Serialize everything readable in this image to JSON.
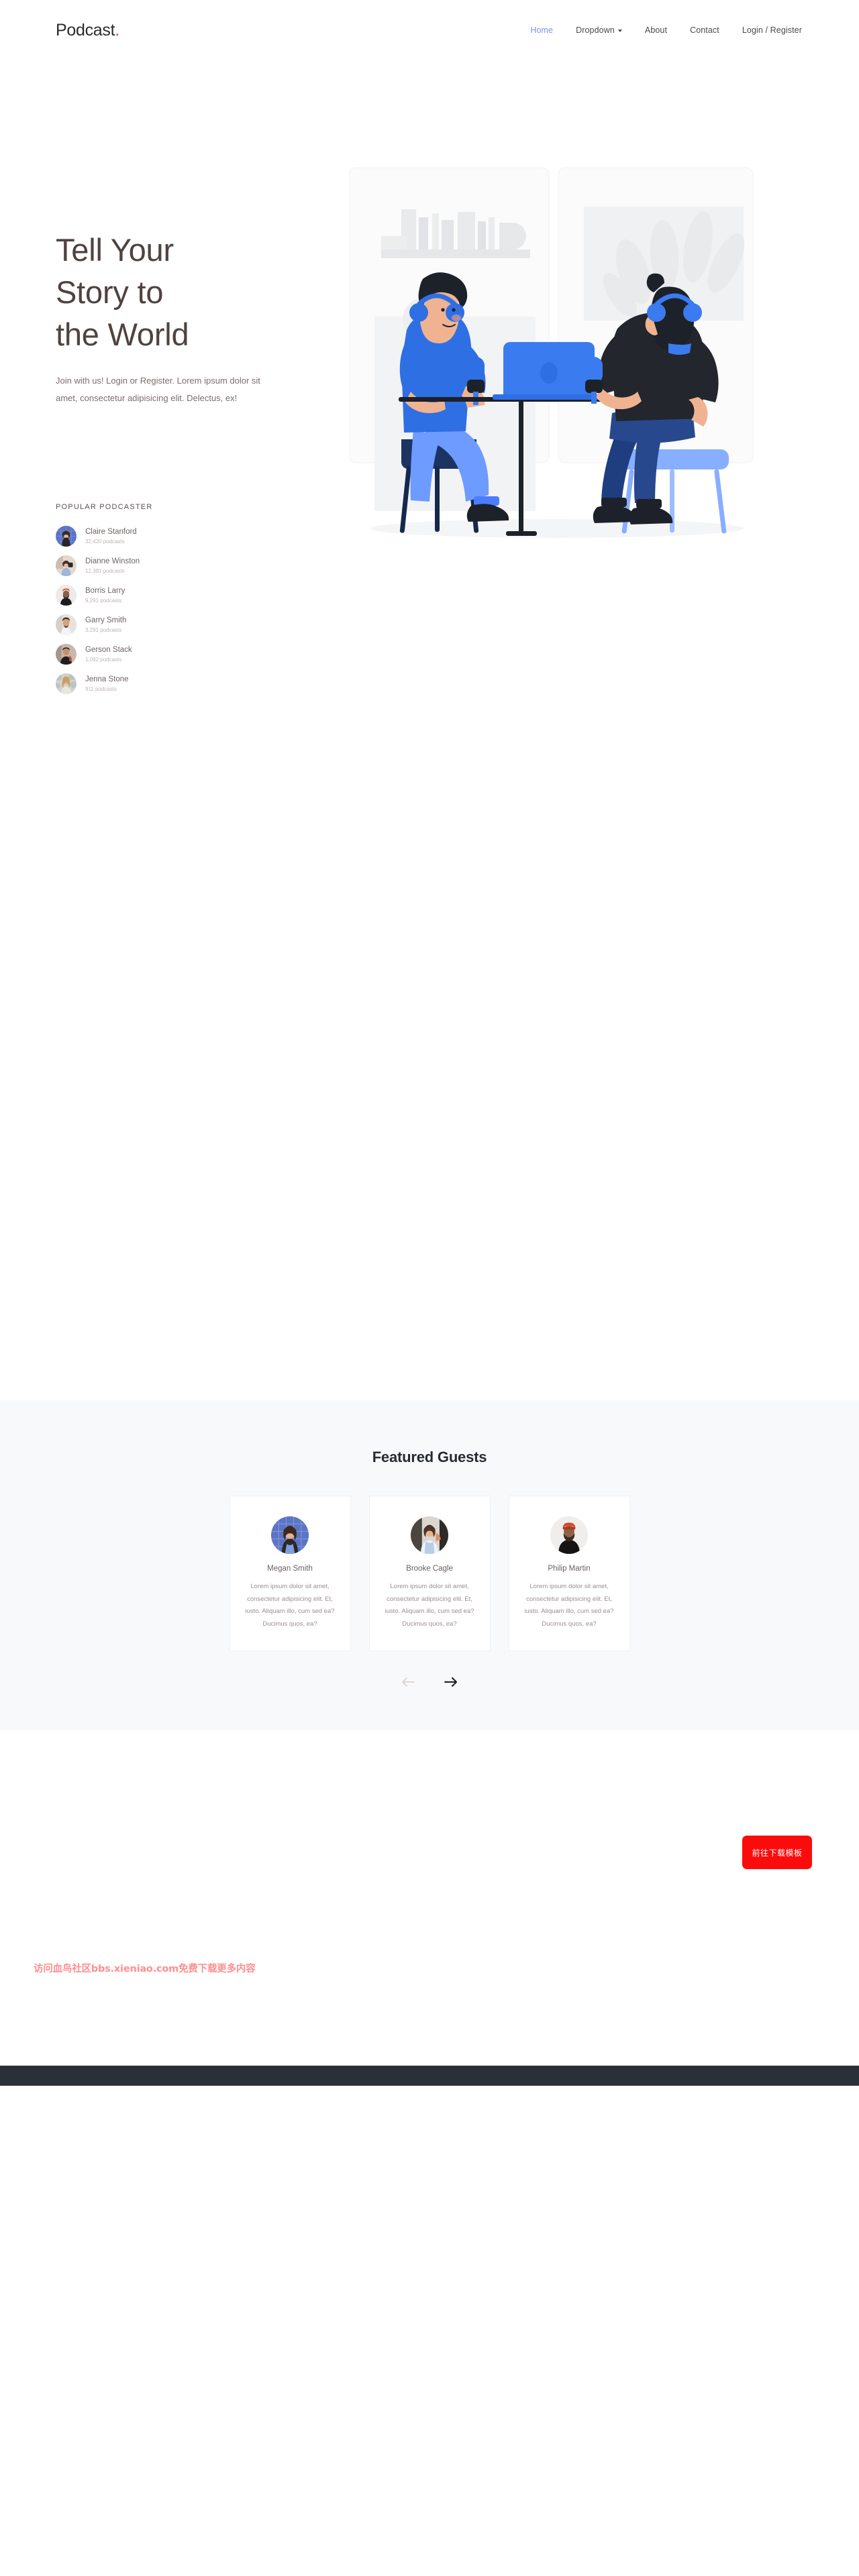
{
  "header": {
    "brand": "Podcast",
    "brand_dot": ".",
    "nav": [
      {
        "label": "Home",
        "active": true,
        "caret": false
      },
      {
        "label": "Dropdown",
        "active": false,
        "caret": true
      },
      {
        "label": "About",
        "active": false,
        "caret": false
      },
      {
        "label": "Contact",
        "active": false,
        "caret": false
      },
      {
        "label": "Login / Register",
        "active": false,
        "caret": false
      }
    ]
  },
  "hero": {
    "title_line1": "Tell Your",
    "title_line2": "Story to",
    "title_line3": "the World",
    "subtitle": "Join with us! Login or Register. Lorem ipsum dolor sit amet, consectetur adipisicing elit. Delectus, ex!",
    "illustration_name": "two-podcasters-at-table-illustration"
  },
  "popular": {
    "title": "POPULAR PODCASTER",
    "items": [
      {
        "name": "Claire Stanford",
        "count": "32,420 podcasts"
      },
      {
        "name": "Dianne Winston",
        "count": "12,381 podcasts"
      },
      {
        "name": "Borris Larry",
        "count": "9,291 podcasts"
      },
      {
        "name": "Garry Smith",
        "count": "3,291 podcasts"
      },
      {
        "name": "Gerson Stack",
        "count": "1,092 podcasts"
      },
      {
        "name": "Jenna Stone",
        "count": "911 podcasts"
      }
    ]
  },
  "guests": {
    "title": "Featured Guests",
    "body_text": "Lorem ipsum dolor sit amet, consectetur adipisicing elit. Et, iusto. Aliquam illo, cum sed ea? Ducimus quos, ea?",
    "cards": [
      {
        "name": "Megan Smith",
        "text": "Lorem ipsum dolor sit amet, consectetur adipisicing elit. Et, iusto. Aliquam illo, cum sed ea? Ducimus quos, ea?"
      },
      {
        "name": "Brooke Cagle",
        "text": "Lorem ipsum dolor sit amet, consectetur adipisicing elit. Et, iusto. Aliquam illo, cum sed ea? Ducimus quos, ea?"
      },
      {
        "name": "Philip Martin",
        "text": "Lorem ipsum dolor sit amet, consectetur adipisicing elit. Et, iusto. Aliquam illo, cum sed ea? Ducimus quos, ea?"
      }
    ],
    "prev_icon": "arrow-left-icon",
    "next_icon": "arrow-right-icon"
  },
  "overlay": {
    "download_button": "前往下载模板",
    "watermark": "访问血鸟社区bbs.xieniao.com免费下载更多内容"
  },
  "colors": {
    "accent_blue": "#7b93e8",
    "brand_dot_red": "#e8342a",
    "illustration_blue": "#2f6fe4",
    "illustration_light_blue": "#6e9bff",
    "guests_bg": "#f8f9fb",
    "download_red": "#fb0c0c",
    "watermark_pink": "#ff8f8f",
    "footer_dark": "#2b2f36"
  }
}
